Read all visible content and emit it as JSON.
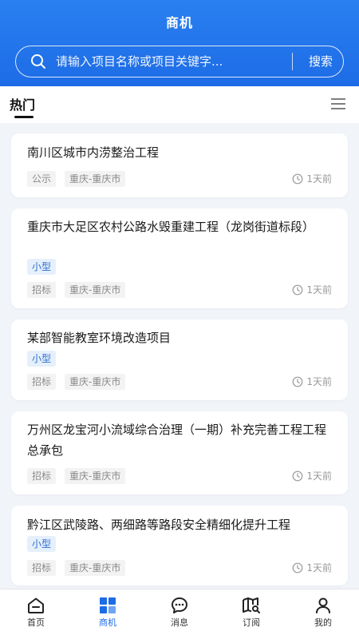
{
  "header": {
    "title": "商机"
  },
  "search": {
    "placeholder": "请输入项目名称或项目关键字...",
    "button_label": "搜索"
  },
  "tabs": {
    "active_label": "热门"
  },
  "projects": [
    {
      "title": "南川区城市内涝整治工程",
      "size": null,
      "type": "公示",
      "region": "重庆-重庆市",
      "time": "1天前"
    },
    {
      "title": "重庆市大足区农村公路水毁重建工程（龙岗街道标段）",
      "size": "小型",
      "type": "招标",
      "region": "重庆-重庆市",
      "time": "1天前"
    },
    {
      "title": "某部智能教室环境改造项目",
      "size": "小型",
      "type": "招标",
      "region": "重庆-重庆市",
      "time": "1天前"
    },
    {
      "title": "万州区龙宝河小流域综合治理（一期）补充完善工程工程总承包",
      "size": null,
      "type": "招标",
      "region": "重庆-重庆市",
      "time": "1天前"
    },
    {
      "title": "黔江区武陵路、两细路等路段安全精细化提升工程",
      "size": "小型",
      "type": "招标",
      "region": "重庆-重庆市",
      "time": "1天前"
    }
  ],
  "bottom_nav": [
    {
      "label": "首页",
      "icon": "home-icon",
      "active": false
    },
    {
      "label": "商机",
      "icon": "grid-icon",
      "active": true
    },
    {
      "label": "消息",
      "icon": "chat-icon",
      "active": false
    },
    {
      "label": "订阅",
      "icon": "map-search-icon",
      "active": false
    },
    {
      "label": "我的",
      "icon": "user-icon",
      "active": false
    }
  ],
  "colors": {
    "primary": "#1d6ce6",
    "badge_bg": "#e6f0fc",
    "badge_text": "#2f6fcf",
    "tag_bg": "#f3f3f3"
  }
}
